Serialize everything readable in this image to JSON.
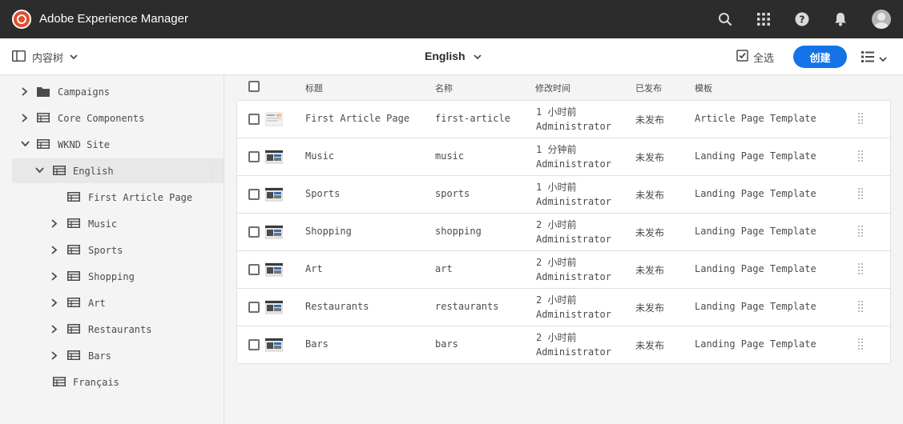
{
  "app": {
    "title": "Adobe Experience Manager"
  },
  "shell_icons": [
    "search-icon",
    "apps-icon",
    "help-icon",
    "bell-icon",
    "avatar"
  ],
  "toolbar": {
    "rail_label": "内容树",
    "breadcrumb": "English",
    "select_all": "全选",
    "create": "创建"
  },
  "tree": [
    {
      "label": "Campaigns",
      "icon": "folder-icon",
      "chevron": "right",
      "level": 0
    },
    {
      "label": "Core Components",
      "icon": "page-icon",
      "chevron": "right",
      "level": 0
    },
    {
      "label": "WKND Site",
      "icon": "page-icon",
      "chevron": "down",
      "level": 0
    },
    {
      "label": "English",
      "icon": "page-icon",
      "chevron": "down",
      "level": 1,
      "selected": true
    },
    {
      "label": "First Article Page",
      "icon": "page-icon",
      "chevron": "none",
      "level": 2
    },
    {
      "label": "Music",
      "icon": "page-icon",
      "chevron": "right",
      "level": 2
    },
    {
      "label": "Sports",
      "icon": "page-icon",
      "chevron": "right",
      "level": 2
    },
    {
      "label": "Shopping",
      "icon": "page-icon",
      "chevron": "right",
      "level": 2
    },
    {
      "label": "Art",
      "icon": "page-icon",
      "chevron": "right",
      "level": 2
    },
    {
      "label": "Restaurants",
      "icon": "page-icon",
      "chevron": "right",
      "level": 2
    },
    {
      "label": "Bars",
      "icon": "page-icon",
      "chevron": "right",
      "level": 2
    },
    {
      "label": "Français",
      "icon": "page-icon",
      "chevron": "none",
      "level": 1
    }
  ],
  "table": {
    "headers": {
      "title": "标题",
      "name": "名称",
      "modified": "修改时间",
      "published": "已发布",
      "template": "模板"
    },
    "rows": [
      {
        "title": "First Article Page",
        "name": "first-article",
        "modified": "1 小时前",
        "by": "Administrator",
        "published": "未发布",
        "template": "Article Page Template"
      },
      {
        "title": "Music",
        "name": "music",
        "modified": "1 分钟前",
        "by": "Administrator",
        "published": "未发布",
        "template": "Landing Page Template"
      },
      {
        "title": "Sports",
        "name": "sports",
        "modified": "1 小时前",
        "by": "Administrator",
        "published": "未发布",
        "template": "Landing Page Template"
      },
      {
        "title": "Shopping",
        "name": "shopping",
        "modified": "2 小时前",
        "by": "Administrator",
        "published": "未发布",
        "template": "Landing Page Template"
      },
      {
        "title": "Art",
        "name": "art",
        "modified": "2 小时前",
        "by": "Administrator",
        "published": "未发布",
        "template": "Landing Page Template"
      },
      {
        "title": "Restaurants",
        "name": "restaurants",
        "modified": "2 小时前",
        "by": "Administrator",
        "published": "未发布",
        "template": "Landing Page Template"
      },
      {
        "title": "Bars",
        "name": "bars",
        "modified": "2 小时前",
        "by": "Administrator",
        "published": "未发布",
        "template": "Landing Page Template"
      }
    ]
  },
  "colors": {
    "shell": "#2c2c2c",
    "accent": "#1473e6",
    "text": "#4b4b4b"
  }
}
